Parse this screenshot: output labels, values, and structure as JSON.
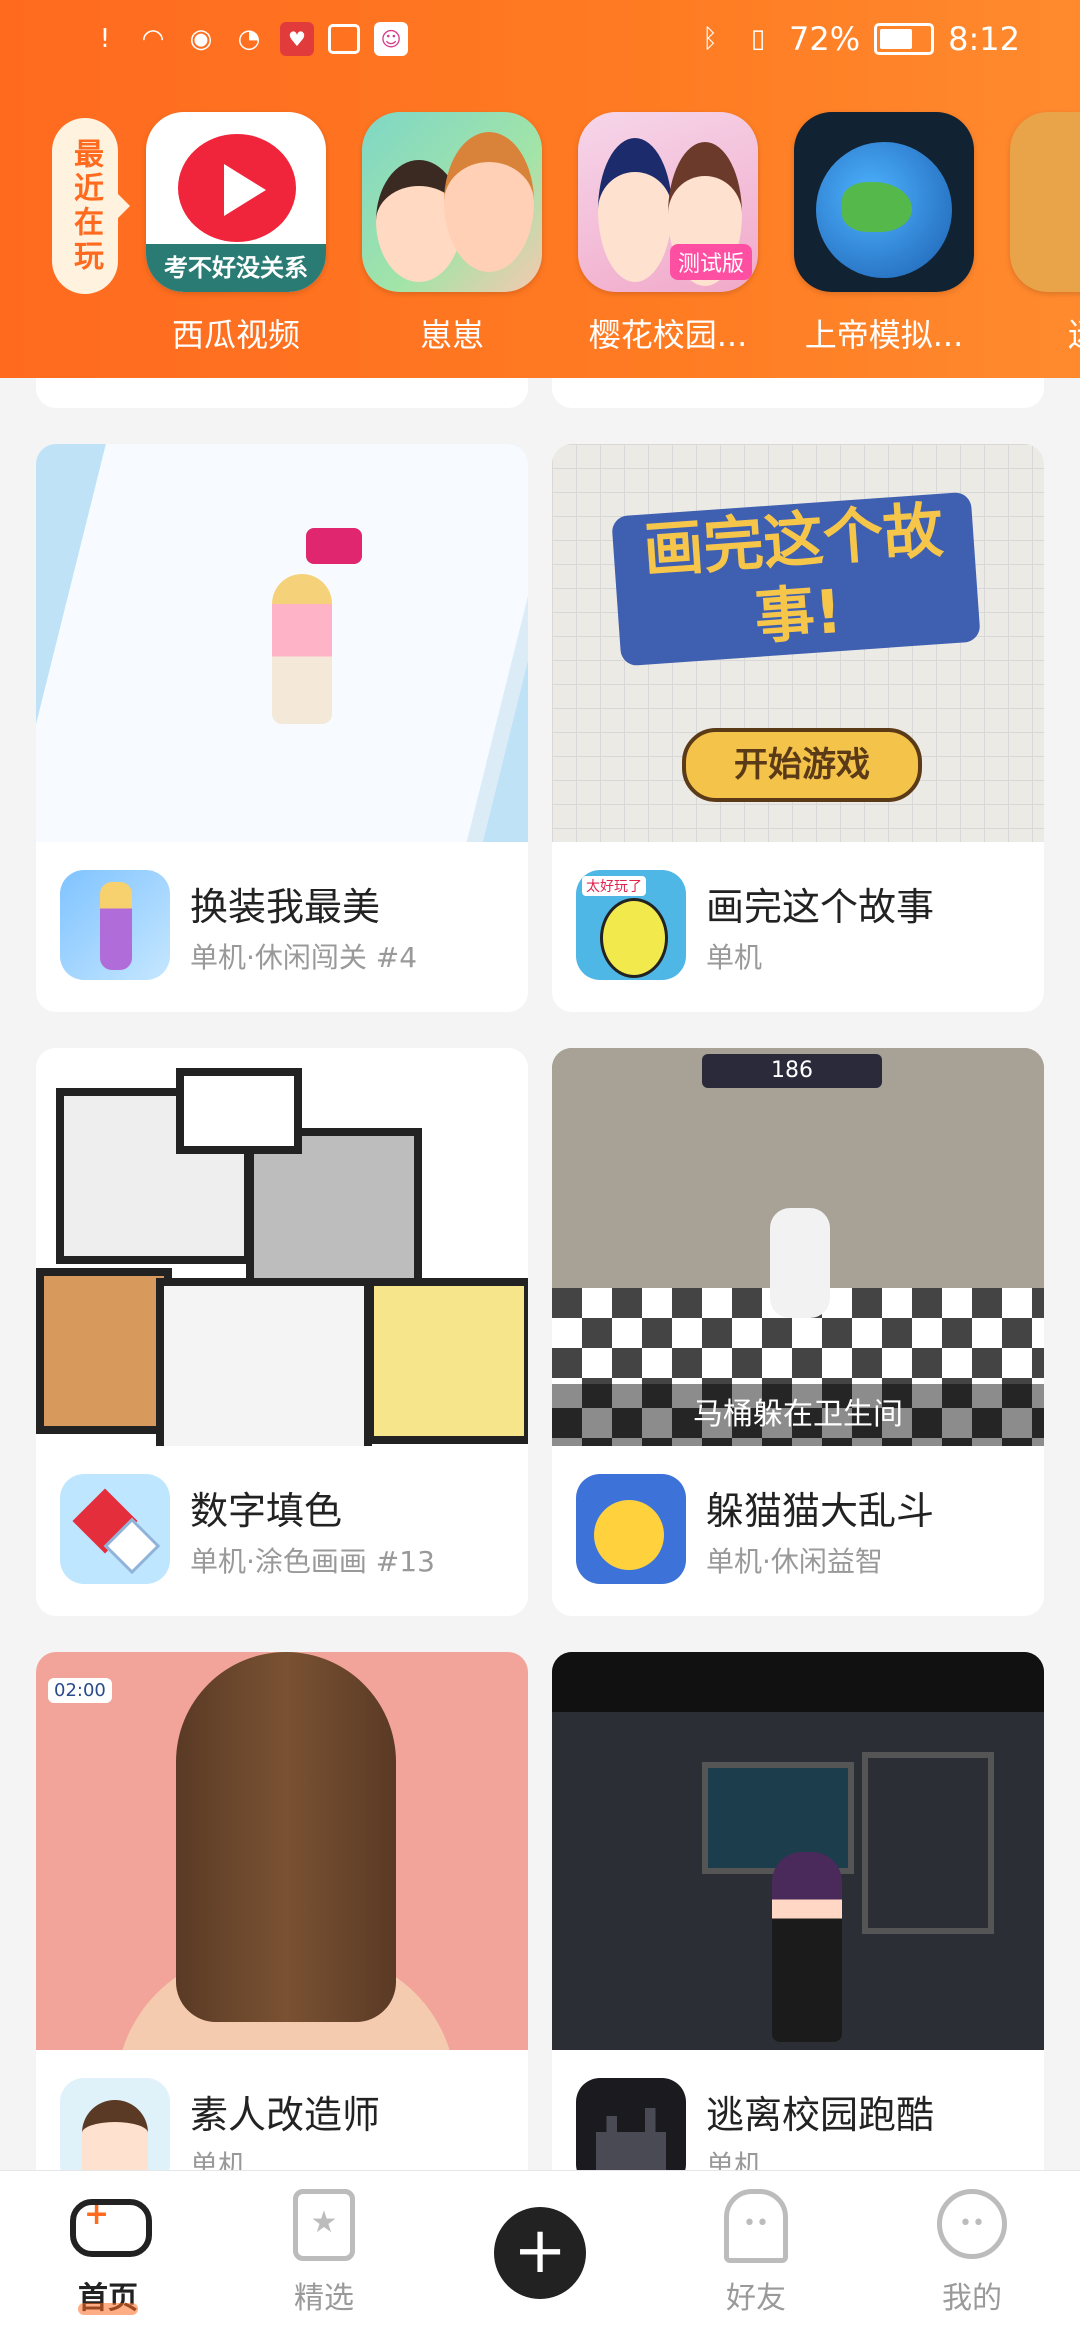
{
  "status_bar": {
    "battery": "72%",
    "battery_level": 0.72,
    "time": "8:12",
    "left_icons": [
      "alert-icon",
      "wifi-icon",
      "eye-icon",
      "alarm-icon",
      "game-app-icon",
      "calendar-icon",
      "face-app-icon"
    ],
    "right_icons": [
      "bluetooth-icon",
      "vibrate-icon",
      "battery-icon"
    ]
  },
  "recent": {
    "label": "最近在玩",
    "items": [
      {
        "name": "西瓜视频",
        "icon_text": "考不好没关系"
      },
      {
        "name": "崽崽",
        "icon_text": ""
      },
      {
        "name": "樱花校园...",
        "icon_text": "测试版"
      },
      {
        "name": "上帝模拟...",
        "icon_text": ""
      },
      {
        "name": "迷你",
        "icon_text": ""
      }
    ]
  },
  "cards": [
    {
      "name": "换装我最美",
      "tag": "单机·休闲闯关 #4",
      "icon_text": ""
    },
    {
      "name": "画完这个故事",
      "tag": "单机",
      "icon_text": "太好玩了",
      "media_title": "画完这个故事!",
      "media_button": "开始游戏"
    },
    {
      "name": "数字填色",
      "tag": "单机·涂色画画 #13",
      "icon_text": ""
    },
    {
      "name": "躲猫猫大乱斗",
      "tag": "单机·休闲益智",
      "icon_text": "",
      "media_caption": "马桶躲在卫生间",
      "hud_text": "186"
    },
    {
      "name": "素人改造师",
      "tag": "单机",
      "icon_text": "",
      "timer": "02:00"
    },
    {
      "name": "逃离校园跑酷",
      "tag": "单机",
      "icon_text": ""
    }
  ],
  "bottom_nav": {
    "items": [
      {
        "label": "首页",
        "icon": "gamepad-icon",
        "active": true
      },
      {
        "label": "精选",
        "icon": "star-bookmark-icon",
        "active": false
      },
      {
        "label": "",
        "icon": "plus-icon",
        "active": false
      },
      {
        "label": "好友",
        "icon": "ghost-icon",
        "active": false
      },
      {
        "label": "我的",
        "icon": "smiley-icon",
        "active": false
      }
    ]
  },
  "colors": {
    "header": "#ff6a1f",
    "accent": "#ff6a1f",
    "background": "#f4f4f4",
    "tag_text": "#999999"
  }
}
